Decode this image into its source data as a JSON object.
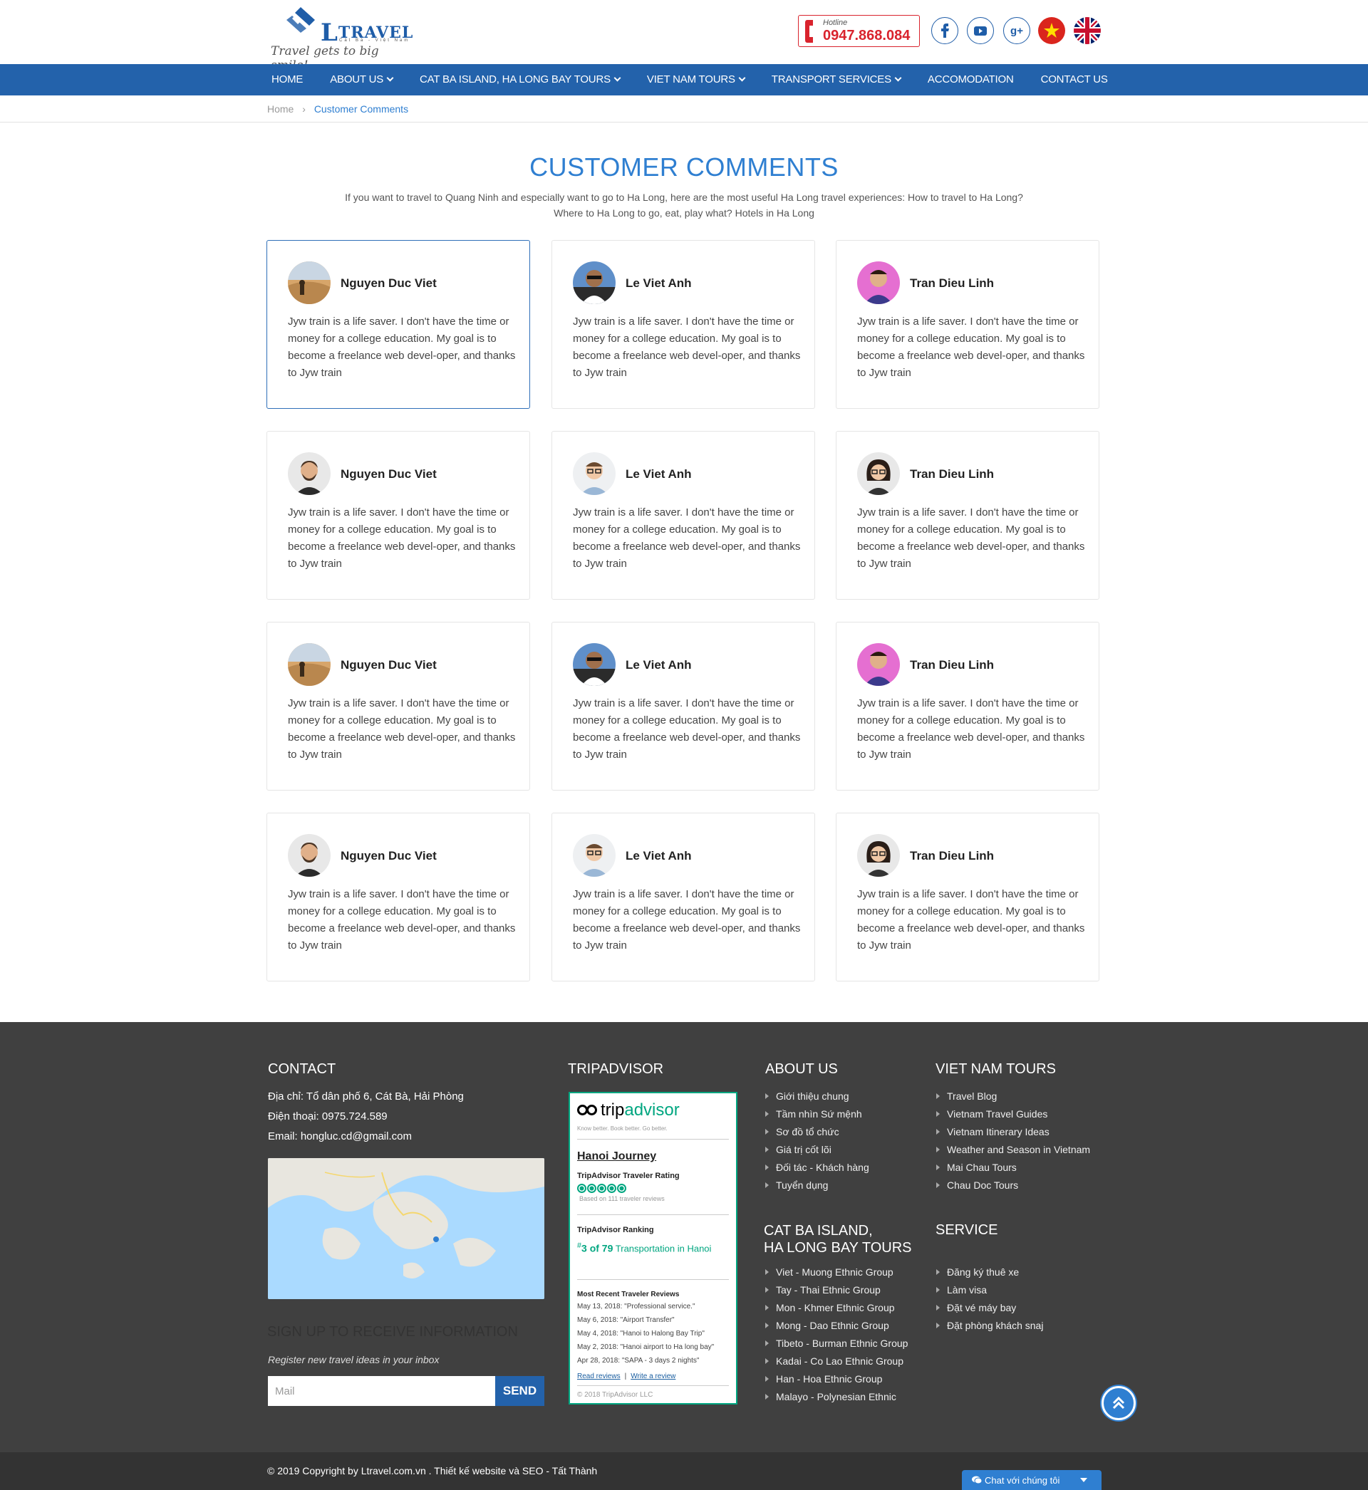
{
  "header": {
    "logo_brand_big": "L",
    "logo_brand": "TRAVEL",
    "logo_sub": "Cát Bà - Việt Nam",
    "slogan": "Travel gets to big smile!",
    "hotline_label": "Hotline",
    "hotline_number": "0947.868.084",
    "social": [
      "facebook-icon",
      "youtube-icon",
      "google-plus-icon"
    ],
    "flags": [
      "vietnam-flag",
      "uk-flag"
    ],
    "google_plus_text": "g+"
  },
  "nav": {
    "items": [
      {
        "label": "HOME",
        "dropdown": false
      },
      {
        "label": "ABOUT US",
        "dropdown": true
      },
      {
        "label": "CAT BA ISLAND, HA LONG BAY TOURS",
        "dropdown": true
      },
      {
        "label": "VIET NAM TOURS",
        "dropdown": true
      },
      {
        "label": "TRANSPORT SERVICES",
        "dropdown": true
      },
      {
        "label": "ACCOMODATION",
        "dropdown": false
      },
      {
        "label": "CONTACT US",
        "dropdown": false
      }
    ]
  },
  "breadcrumb": {
    "home": "Home",
    "separator": "›",
    "current": "Customer Comments"
  },
  "main": {
    "title": "CUSTOMER COMMENTS",
    "intro": "If you want to travel to Quang Ninh and especially want to go to Ha Long, here are the most useful Ha Long travel experiences: How to travel to Ha Long? Where to Ha Long to go, eat, play what? Hotels in Ha Long",
    "comments": [
      {
        "name": "Nguyen Duc Viet",
        "text": "Jyw train is a life saver. I don't have the time or money for a college education. My goal is to become a freelance web devel-oper, and thanks to Jyw train",
        "avatar": "desert-photo"
      },
      {
        "name": "Le Viet Anh",
        "text": "Jyw train is a life saver. I don't have the time or money for a college education. My goal is to become a freelance web devel-oper, and thanks to Jyw train",
        "avatar": "man-sunglasses-photo"
      },
      {
        "name": "Tran Dieu Linh",
        "text": "Jyw train is a life saver. I don't have the time or money for a college education. My goal is to become a freelance web devel-oper, and thanks to Jyw train",
        "avatar": "man-pink-bg-photo"
      },
      {
        "name": "Nguyen Duc Viet",
        "text": "Jyw train is a life saver. I don't have the time or money for a college education. My goal is to become a freelance web devel-oper, and thanks to Jyw train",
        "avatar": "man-beard-photo"
      },
      {
        "name": "Le Viet Anh",
        "text": "Jyw train is a life saver. I don't have the time or money for a college education. My goal is to become a freelance web devel-oper, and thanks to Jyw train",
        "avatar": "man-glasses-photo"
      },
      {
        "name": "Tran Dieu Linh",
        "text": "Jyw train is a life saver. I don't have the time or money for a college education. My goal is to become a freelance web devel-oper, and thanks to Jyw train",
        "avatar": "woman-glasses-photo"
      },
      {
        "name": "Nguyen Duc Viet",
        "text": "Jyw train is a life saver. I don't have the time or money for a college education. My goal is to become a freelance web devel-oper, and thanks to Jyw train",
        "avatar": "desert-photo"
      },
      {
        "name": "Le Viet Anh",
        "text": "Jyw train is a life saver. I don't have the time or money for a college education. My goal is to become a freelance web devel-oper, and thanks to Jyw train",
        "avatar": "man-sunglasses-photo"
      },
      {
        "name": "Tran Dieu Linh",
        "text": "Jyw train is a life saver. I don't have the time or money for a college education. My goal is to become a freelance web devel-oper, and thanks to Jyw train",
        "avatar": "man-pink-bg-photo"
      },
      {
        "name": "Nguyen Duc Viet",
        "text": "Jyw train is a life saver. I don't have the time or money for a college education. My goal is to become a freelance web devel-oper, and thanks to Jyw train",
        "avatar": "man-beard-photo"
      },
      {
        "name": "Le Viet Anh",
        "text": "Jyw train is a life saver. I don't have the time or money for a college education. My goal is to become a freelance web devel-oper, and thanks to Jyw train",
        "avatar": "man-glasses-photo"
      },
      {
        "name": "Tran Dieu Linh",
        "text": "Jyw train is a life saver. I don't have the time or money for a college education. My goal is to become a freelance web devel-oper, and thanks to Jyw train",
        "avatar": "woman-glasses-photo"
      }
    ]
  },
  "footer": {
    "contact": {
      "title": "CONTACT",
      "address": "Địa chỉ: Tổ dân phố 6, Cát Bà, Hải Phòng",
      "phone": "Điện thoại: 0975.724.589",
      "email": "Email: hongluc.cd@gmail.com"
    },
    "signup": {
      "title": "SIGN UP TO RECEIVE INFORMATION",
      "subtitle": "Register new travel ideas in your inbox",
      "placeholder": "Mail",
      "button": "SEND"
    },
    "tripadvisor": {
      "title": "TRIPADVISOR",
      "brand_trip": "trip",
      "brand_advisor": "advisor",
      "tagline": "Know better. Book better. Go better.",
      "place": "Hanoi Journey",
      "rating_label": "TripAdvisor Traveler Rating",
      "based_on": "Based on 111 traveler reviews",
      "ranking_label": "TripAdvisor Ranking",
      "ranking_hash": "#",
      "ranking_value": "3 of 79",
      "ranking_rest": "Transportation in Hanoi",
      "recent_label": "Most Recent Traveler Reviews",
      "reviews": [
        "May 13, 2018: \"Professional service.\"",
        "May 6, 2018: \"Airport Transfer\"",
        "May 4, 2018: \"Hanoi to Halong Bay Trip\"",
        "May 2, 2018: \"Hanoi airport to Ha long bay\"",
        "Apr 28, 2018: \"SAPA - 3 days 2 nights\""
      ],
      "read_reviews": "Read reviews",
      "divider": "|",
      "write_review": "Write a review",
      "copyright": "© 2018 TripAdvisor LLC"
    },
    "about": {
      "title": "ABOUT US",
      "items": [
        "Giới thiệu chung",
        "Tầm nhìn Sứ mệnh",
        "Sơ đồ tổ chức",
        "Giá trị cốt lõi",
        "Đối tác - Khách hàng",
        "Tuyển dụng"
      ]
    },
    "catba": {
      "title_line1": "CAT BA ISLAND,",
      "title_line2": "HA LONG BAY TOURS",
      "items": [
        "Viet - Muong Ethnic Group",
        "Tay - Thai Ethnic Group",
        "Mon - Khmer Ethnic Group",
        "Mong - Dao Ethnic Group",
        "Tibeto - Burman Ethnic Group",
        "Kadai - Co Lao Ethnic Group",
        "Han - Hoa Ethnic Group",
        "Malayo - Polynesian Ethnic"
      ]
    },
    "vntours": {
      "title": "VIET NAM TOURS",
      "items": [
        "Travel Blog",
        "Vietnam Travel Guides",
        "Vietnam Itinerary Ideas",
        "Weather and Season in Vietnam",
        "Mai Chau Tours",
        "Chau Doc Tours"
      ]
    },
    "service": {
      "title": "SERVICE",
      "items": [
        "Đăng ký thuê xe",
        "Làm visa",
        "Đặt vé máy bay",
        "Đặt phòng khách snaj"
      ]
    }
  },
  "bottom": {
    "copyright": "© 2019 Copyright by Ltravel.com.vn . Thiết kế website và SEO - Tất Thành",
    "chat_label": "Chat với chúng tôi"
  },
  "colors": {
    "primary": "#2362ab",
    "accent": "#2f7fd1",
    "hotline_red": "#d9232d",
    "footer_bg": "#404040",
    "tripadvisor_green": "#00a680"
  }
}
